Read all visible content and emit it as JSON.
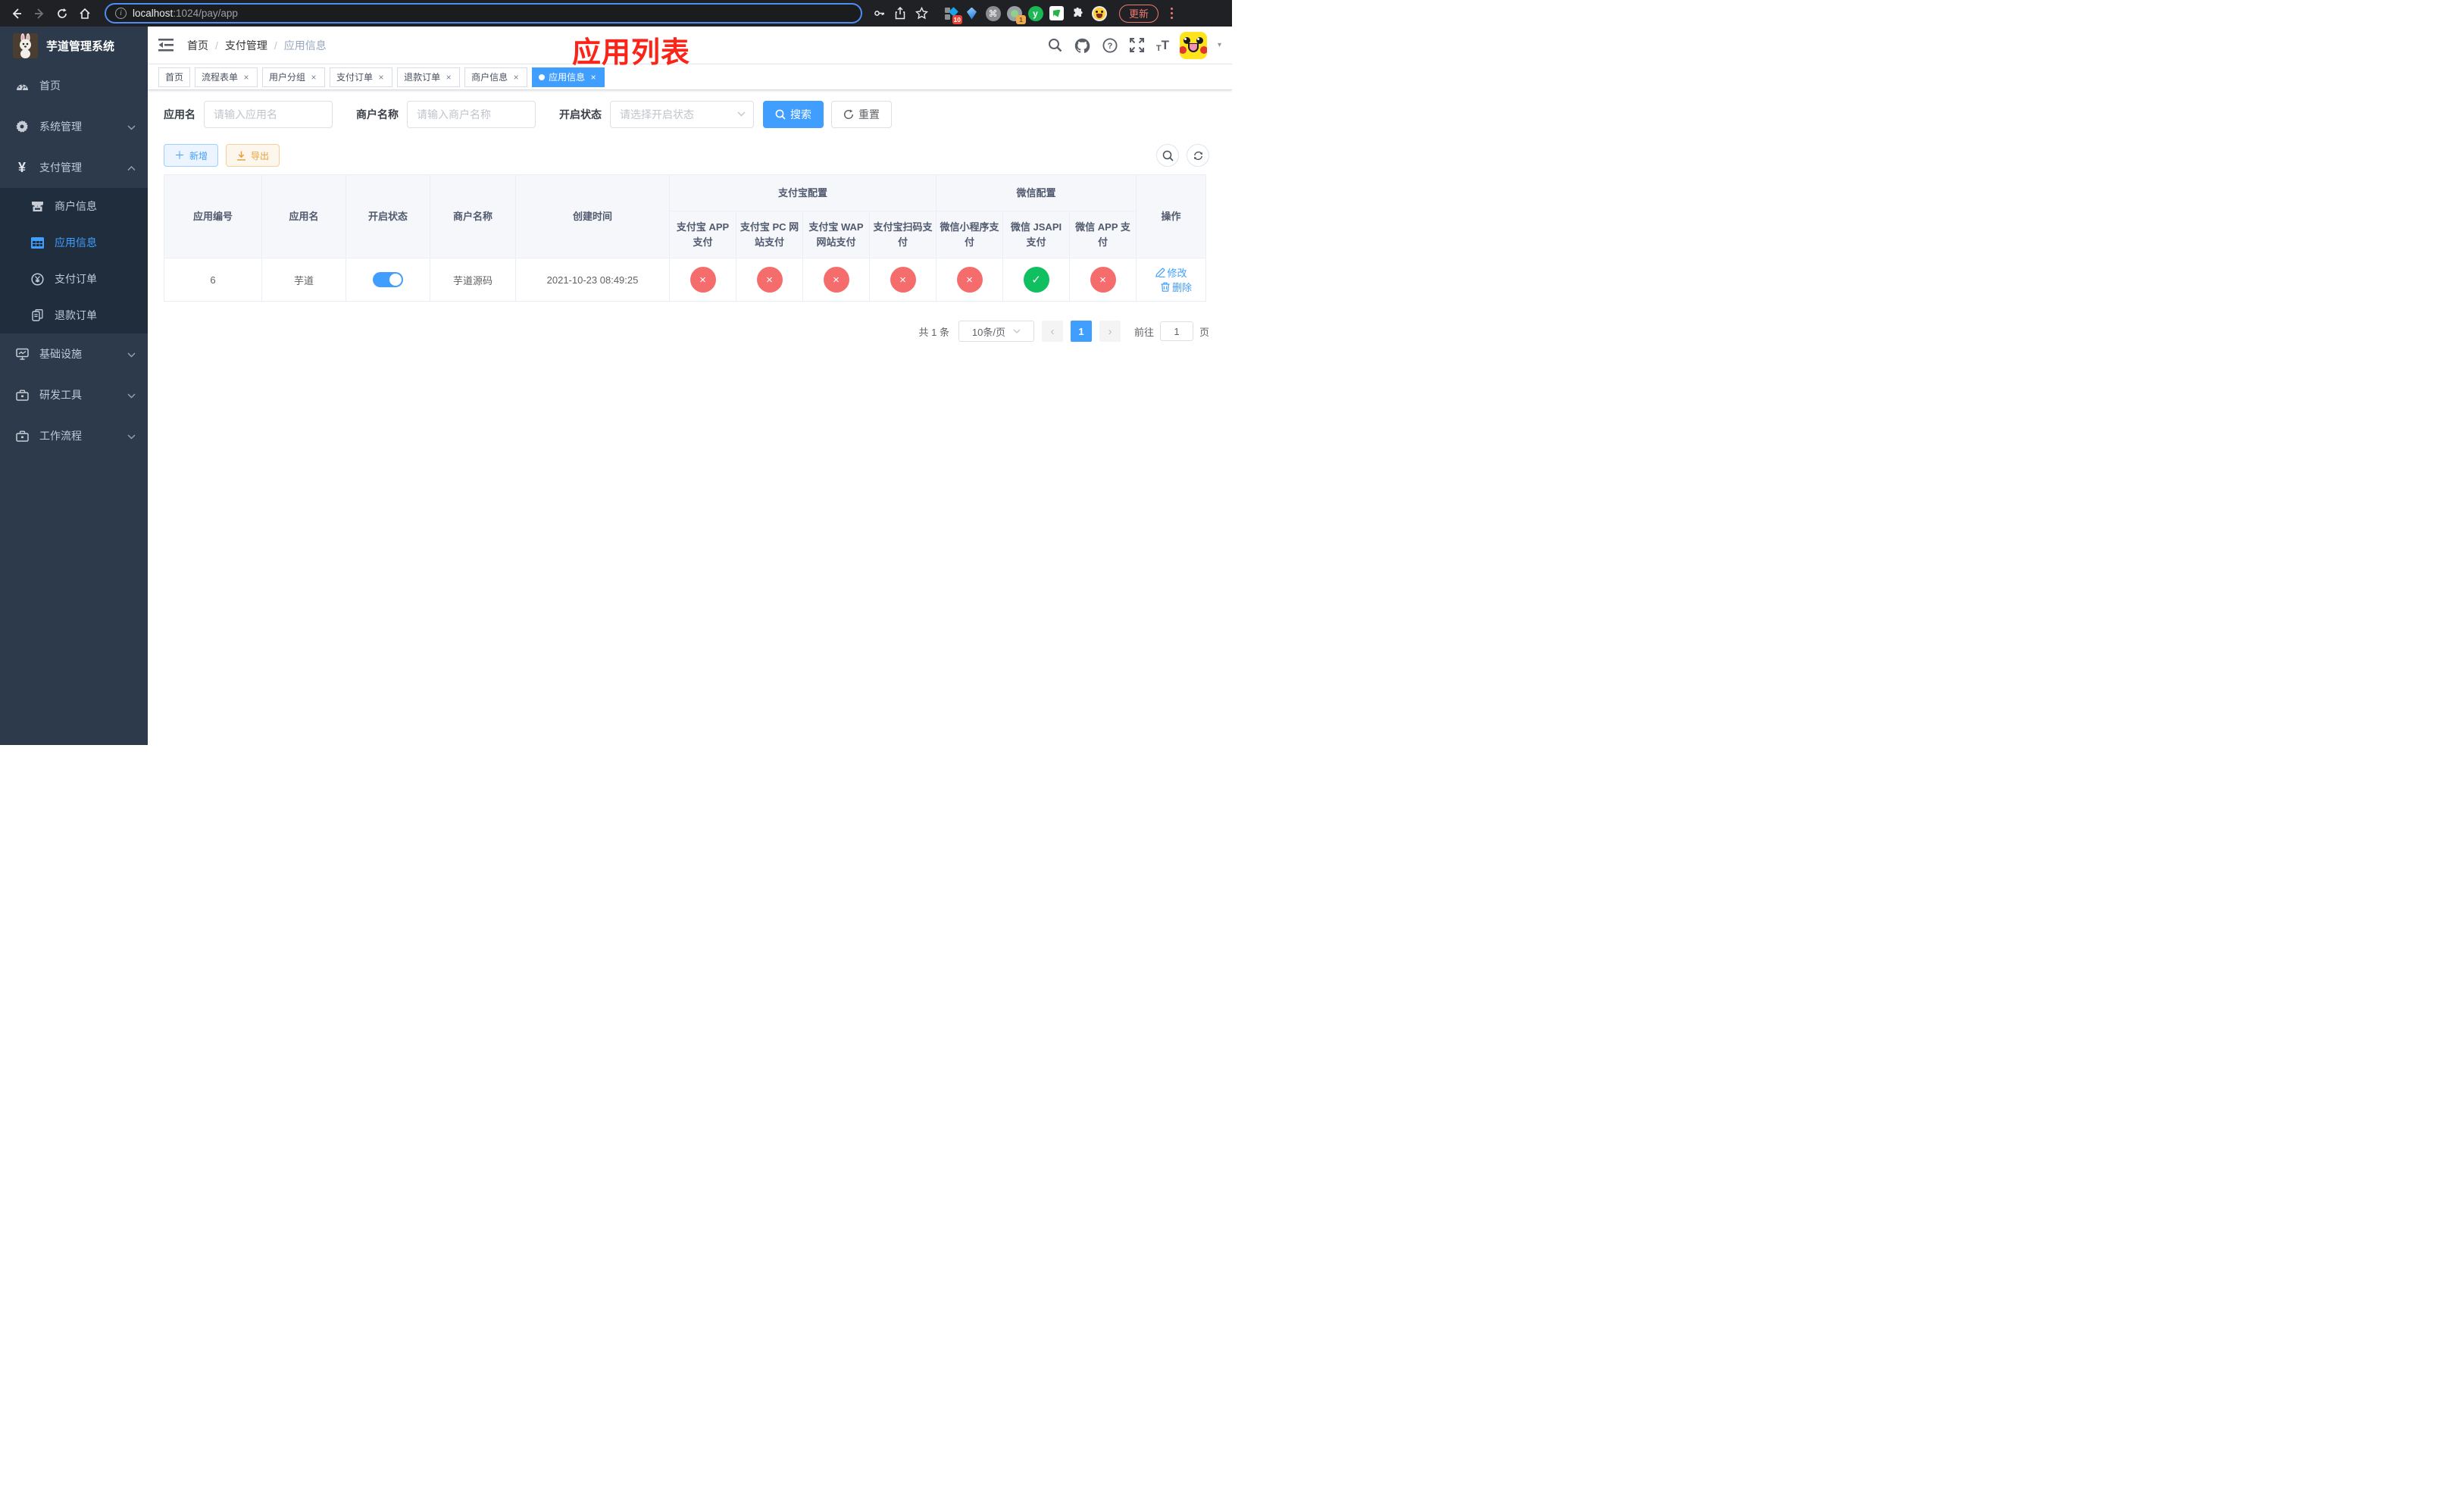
{
  "browser": {
    "url": {
      "host": "localhost",
      "rest": ":1024/pay/app"
    },
    "update_label": "更新",
    "badges": {
      "tiles": "10",
      "session": "1"
    },
    "ext_y_label": "y"
  },
  "sidebar": {
    "title": "芋道管理系统",
    "items": [
      {
        "label": "首页"
      },
      {
        "label": "系统管理"
      },
      {
        "label": "支付管理"
      },
      {
        "label": "商户信息"
      },
      {
        "label": "应用信息"
      },
      {
        "label": "支付订单"
      },
      {
        "label": "退款订单"
      },
      {
        "label": "基础设施"
      },
      {
        "label": "研发工具"
      },
      {
        "label": "工作流程"
      }
    ]
  },
  "header": {
    "breadcrumb": [
      "首页",
      "支付管理",
      "应用信息"
    ],
    "overlay_title": "应用列表",
    "font_icon_small": "T",
    "font_icon_big": "T",
    "caret": "▾"
  },
  "tabs": [
    {
      "label": "首页"
    },
    {
      "label": "流程表单",
      "close": "×"
    },
    {
      "label": "用户分组",
      "close": "×"
    },
    {
      "label": "支付订单",
      "close": "×"
    },
    {
      "label": "退款订单",
      "close": "×"
    },
    {
      "label": "商户信息",
      "close": "×"
    },
    {
      "label": "应用信息",
      "close": "×"
    }
  ],
  "filters": {
    "app_name": {
      "label": "应用名",
      "placeholder": "请输入应用名"
    },
    "merchant": {
      "label": "商户名称",
      "placeholder": "请输入商户名称"
    },
    "status": {
      "label": "开启状态",
      "placeholder": "请选择开启状态"
    },
    "search_label": "搜索",
    "reset_label": "重置"
  },
  "toolbar": {
    "add_label": "新增",
    "export_label": "导出"
  },
  "table": {
    "columns": {
      "id": "应用编号",
      "name": "应用名",
      "status": "开启状态",
      "merchant": "商户名称",
      "created": "创建时间",
      "actions": "操作"
    },
    "groups": {
      "alipay": "支付宝配置",
      "wechat": "微信配置"
    },
    "pay_columns": [
      "支付宝 APP 支付",
      "支付宝 PC 网站支付",
      "支付宝 WAP 网站支付",
      "支付宝扫码支付",
      "微信小程序支付",
      "微信 JSAPI 支付",
      "微信 APP 支付"
    ],
    "row": {
      "id": "6",
      "name": "芋道",
      "enabled": true,
      "merchant": "芋道源码",
      "created": "2021-10-23 08:49:25",
      "pay_status": [
        false,
        false,
        false,
        false,
        false,
        true,
        false
      ],
      "edit_label": "修改",
      "delete_label": "删除"
    },
    "status_glyphs": {
      "ok": "✓",
      "fail": "×"
    },
    "status_colors": {
      "ok": "#0fbf60",
      "fail": "#f56c6c"
    }
  },
  "pagination": {
    "total": "共 1 条",
    "page_size": "10条/页",
    "prev": "‹",
    "next": "›",
    "current": "1",
    "goto_label": "前往",
    "goto_value": "1",
    "unit_label": "页"
  }
}
